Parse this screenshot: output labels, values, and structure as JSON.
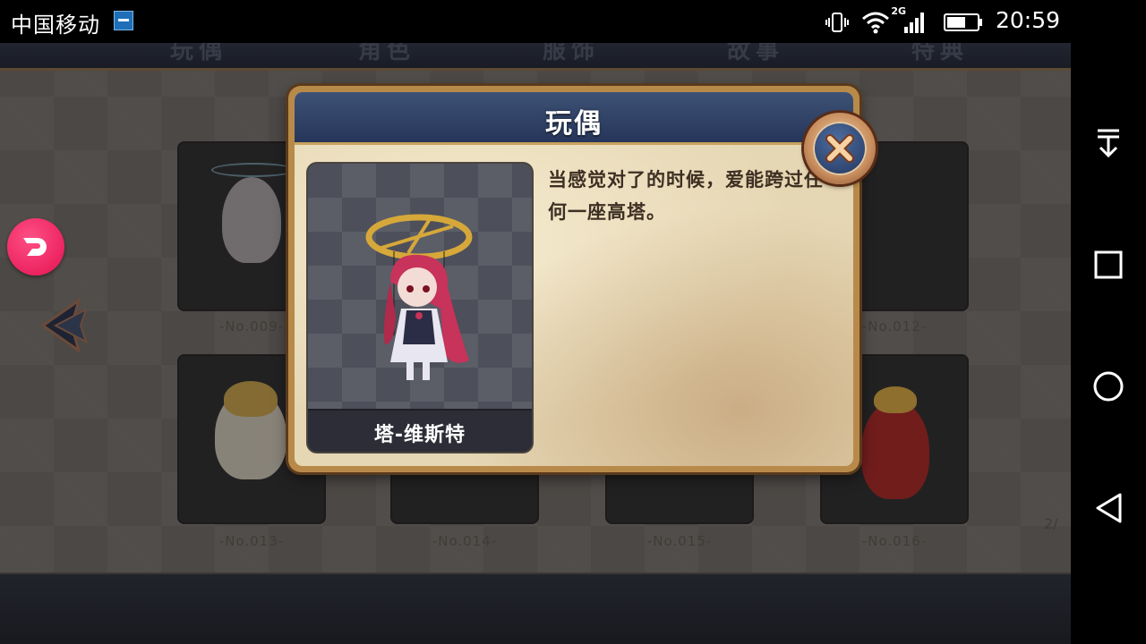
{
  "status_bar": {
    "carrier": "中国移动",
    "network_type": "2G",
    "time": "20:59",
    "battery_level": 0.62
  },
  "game": {
    "top_tabs": [
      "玩偶",
      "角色",
      "服饰",
      "故事",
      "特典"
    ],
    "cards": [
      {
        "number": "-No.009-"
      },
      {
        "number": "-No.012-"
      },
      {
        "number": "-No.013-"
      },
      {
        "number": "-No.014-"
      },
      {
        "number": "-No.015-"
      },
      {
        "number": "-No.016-"
      }
    ],
    "page_indicator": "2/"
  },
  "dialog": {
    "title": "玩偶",
    "character_name": "塔-维斯特",
    "description": "当感觉对了的时候，爱能跨过任何一座高塔。"
  },
  "colors": {
    "dialog_header": "#2f4268",
    "dialog_parchment": "#e6d7b4",
    "dialog_border": "#b88a4a",
    "logo_pink": "#e4124f"
  }
}
